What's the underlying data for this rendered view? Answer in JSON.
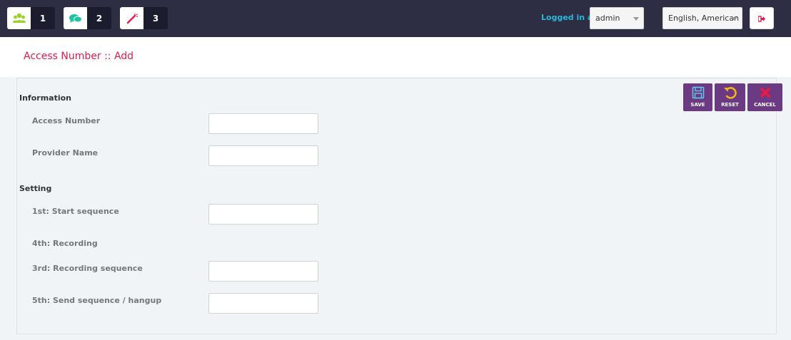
{
  "topbar": {
    "badges": [
      {
        "icon": "users-icon",
        "count": "1"
      },
      {
        "icon": "comments-icon",
        "count": "2"
      },
      {
        "icon": "magic-wand-icon",
        "count": "3"
      }
    ],
    "logged_in_label": "Logged in as :",
    "user_value": "admin",
    "language_value": "English, American",
    "logout_icon": "sign-out-icon"
  },
  "header": {
    "title": "Access Number :: Add"
  },
  "actions": {
    "save": "SAVE",
    "reset": "RESET",
    "cancel": "CANCEL"
  },
  "form": {
    "information_title": "Information",
    "access_number_label": "Access Number",
    "access_number_value": "",
    "provider_name_label": "Provider Name",
    "provider_name_value": "",
    "setting_title": "Setting",
    "start_sequence_label": "1st: Start sequence",
    "start_sequence_value": "",
    "recording_label": "4th: Recording",
    "recording_sequence_label": "3rd: Recording sequence",
    "recording_sequence_value": "",
    "send_sequence_label": "5th: Send sequence / hangup",
    "send_sequence_value": ""
  },
  "colors": {
    "topbar": "#2d2e43",
    "title": "#e8194a",
    "logged_label": "#29b6d8",
    "action_button": "#6b3a82"
  }
}
